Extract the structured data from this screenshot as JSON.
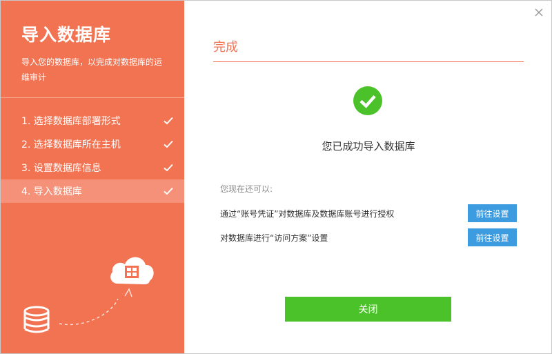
{
  "sidebar": {
    "title": "导入数据库",
    "description": "导入您的数据库，以完成对数据库的运维审计",
    "steps": [
      {
        "label": "1. 选择数据库部署形式"
      },
      {
        "label": "2. 选择数据库所在主机"
      },
      {
        "label": "3. 设置数据库信息"
      },
      {
        "label": "4. 导入数据库"
      }
    ],
    "active_step": 4
  },
  "main": {
    "title": "完成",
    "success_message": "您已成功导入数据库",
    "next_label": "您现在还可以:",
    "actions": [
      {
        "text": "通过“账号凭证”对数据库及数据库账号进行授权",
        "button": "前往设置"
      },
      {
        "text": "对数据库进行“访问方案”设置",
        "button": "前往设置"
      }
    ],
    "close_button": "关闭"
  },
  "icons": [
    "close-icon",
    "check-icon",
    "success-check-icon",
    "cloud-upload-icon",
    "database-icon",
    "arrow-icon"
  ],
  "colors": {
    "accent": "#f27352",
    "success": "#4cc22a",
    "link_button": "#3d9be0"
  }
}
